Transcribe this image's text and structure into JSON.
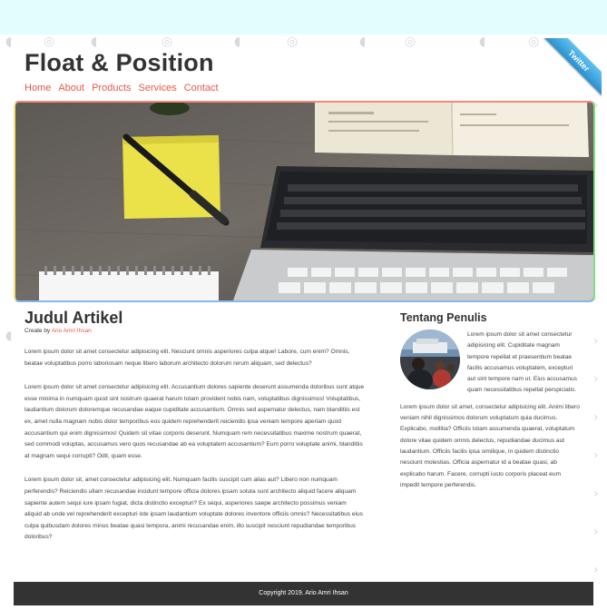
{
  "site": {
    "title": "Float & Position"
  },
  "nav": {
    "items": [
      "Home",
      "About",
      "Products",
      "Services",
      "Contact"
    ]
  },
  "ribbon": {
    "label": "Twitter",
    "color": "#3aa6e2"
  },
  "hero": {
    "image": "desk-with-notepad-pen-laptop-book"
  },
  "article": {
    "title": "Judul Artikel",
    "byline_prefix": "Create by",
    "author": "Ario Amri Ihsan",
    "paragraphs": [
      "Lorem ipsum dolor sit amet consectetur adipisicing elit. Nesciunt omnis asperiores culpa atque! Labore, cum enim? Omnis, beatae voluptatibus porro laboriosam neque libero laborum architecto dolorum rerum aliquam, sed delectus?",
      "Lorem ipsum dolor sit amet consectetur adipisicing elit. Accusantium dolores sapiente deserunt assumenda doloribus sunt atque esse minima in numquam quod sint nostrum quaerat harum totam provident nobis nam, voluptatibus dignissimos! Voluptatibus, laudantium dolorum doloremque recusandae eaque cupiditate accusantium. Omnis sed aspernatur delectus, nam blanditiis est ex, amet nulla magnam nobis dolor temporibus eos quidem reprehenderit reiciendis ipsa veniam tempore aperiam quod accusantium qui enim dignissimos! Quidem sit vitae corporis deserunt. Numquam rem necessitatibus maxime nostrum quaerat, sed commodi voluptas, accusamus vero quos recusandae ab ea voluptatem accusantium? Eum porro voluptate animi, blanditiis at magnam sequi corrupti? Odit, quam esse.",
      "Lorem ipsum dolor sit, amet consectetur adipisicing elit. Numquam facilis suscipit cum alias aut? Libero non numquam perferendis? Reiciendis ullam recusandae incidunt tempore officia dolores ipsam soluta sunt architecto aliquid facere aliquam sapiente autem sequi iure ipsam fugiat, dicta distinctio excepturi? Ex sequi, asperiores saepe architecto possimus veniam aliquid ab unde vel reprehenderit excepturi iste ipsam laudantium voluptate dolores inventore officiis omnis? Necessitatibus eius culpa quibusdam dolores minus beatae quasi tempora, animi recusandae enim, illo suscipit nesciunt repudiandae temporibus doloribus?"
    ]
  },
  "aside": {
    "title": "Tentang Penulis",
    "profile_image": "author-photo-on-ferry",
    "paragraphs": [
      "Lorem ipsum dolor sit amet consectetur adipisicing elit. Cupiditate magnam tempore repellat et praesentium beatae facilis accusamus voluptatem, excepturi aut sint tempore nam ut. Eius accusamus quam necessitatibus repellat perspiciatis.",
      "Lorem ipsum dolor sit amet, consectetur adipisicing elit. Animi libero veniam nihil dignissimos dolorum voluptatum quia ducimus. Explicabo, mollitia? Officiis totam assumenda quaerat, voluptatum dolore vitae quidem omnis delectus, repudiandae ducimus aut laudantium. Officiis facilis ipsa similique, in quidem distinctio nesciunt molestias. Officia aspernatur id a beatae quasi, ab explicabo harum. Facere, corrupti iusto corporis placeat eum impedit tempore perferendis."
    ]
  },
  "footer": {
    "copyright": "Copyright 2019. Ario Amri Ihsan"
  },
  "colors": {
    "topbar": "#e1fdfe",
    "accent": "#e8574d",
    "footer_bg": "#333333"
  }
}
